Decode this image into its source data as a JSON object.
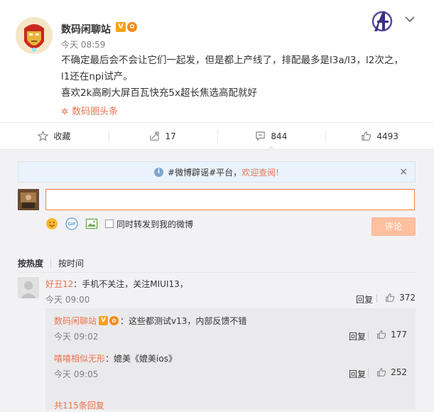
{
  "post": {
    "author": "数码闲聊站",
    "badge_v": "V",
    "time": "今天 08:59",
    "lines": [
      "不确定最后会不会让它们一起发，但是都上产线了，排配最多是l3a/l3，l2次之，",
      "l1还在npi试产。",
      "喜欢2k高刷大屏百瓦快充5x超长焦选高配就好"
    ],
    "source": "数码圈头条"
  },
  "actions": {
    "favorite": "收藏",
    "repost_count": "17",
    "comment_count": "844",
    "like_count": "4493"
  },
  "notice": {
    "prefix": "#微博辟谣#平台，",
    "highlight": "欢迎查阅!",
    "close": "×"
  },
  "composer": {
    "input_value": "",
    "also_repost": "同时转发到我的微博",
    "submit": "评论"
  },
  "sort": {
    "hot": "按热度",
    "time": "按时间"
  },
  "comment": {
    "user": "好丑12",
    "text": "：手机不关注，关注MIUI13，",
    "time": "今天 09:00",
    "reply": "回复",
    "likes": "372"
  },
  "replies": [
    {
      "user": "数码闲聊站",
      "text": "：这些都测试v13，内部反馈不错",
      "time": "今天 09:02",
      "reply": "回复",
      "likes": "177",
      "verified": true
    },
    {
      "user": "嘻嘻相似无形",
      "text": "：媲美《媲美ios》",
      "time": "今天 09:05",
      "reply": "回复",
      "likes": "252",
      "verified": false
    }
  ],
  "more_replies": "共115条回复",
  "colors": {
    "accent": "#eb7350",
    "input_border": "#fa7d3c",
    "submit_disabled": "#ffc09f",
    "notice_bg": "#eaf2fc"
  }
}
